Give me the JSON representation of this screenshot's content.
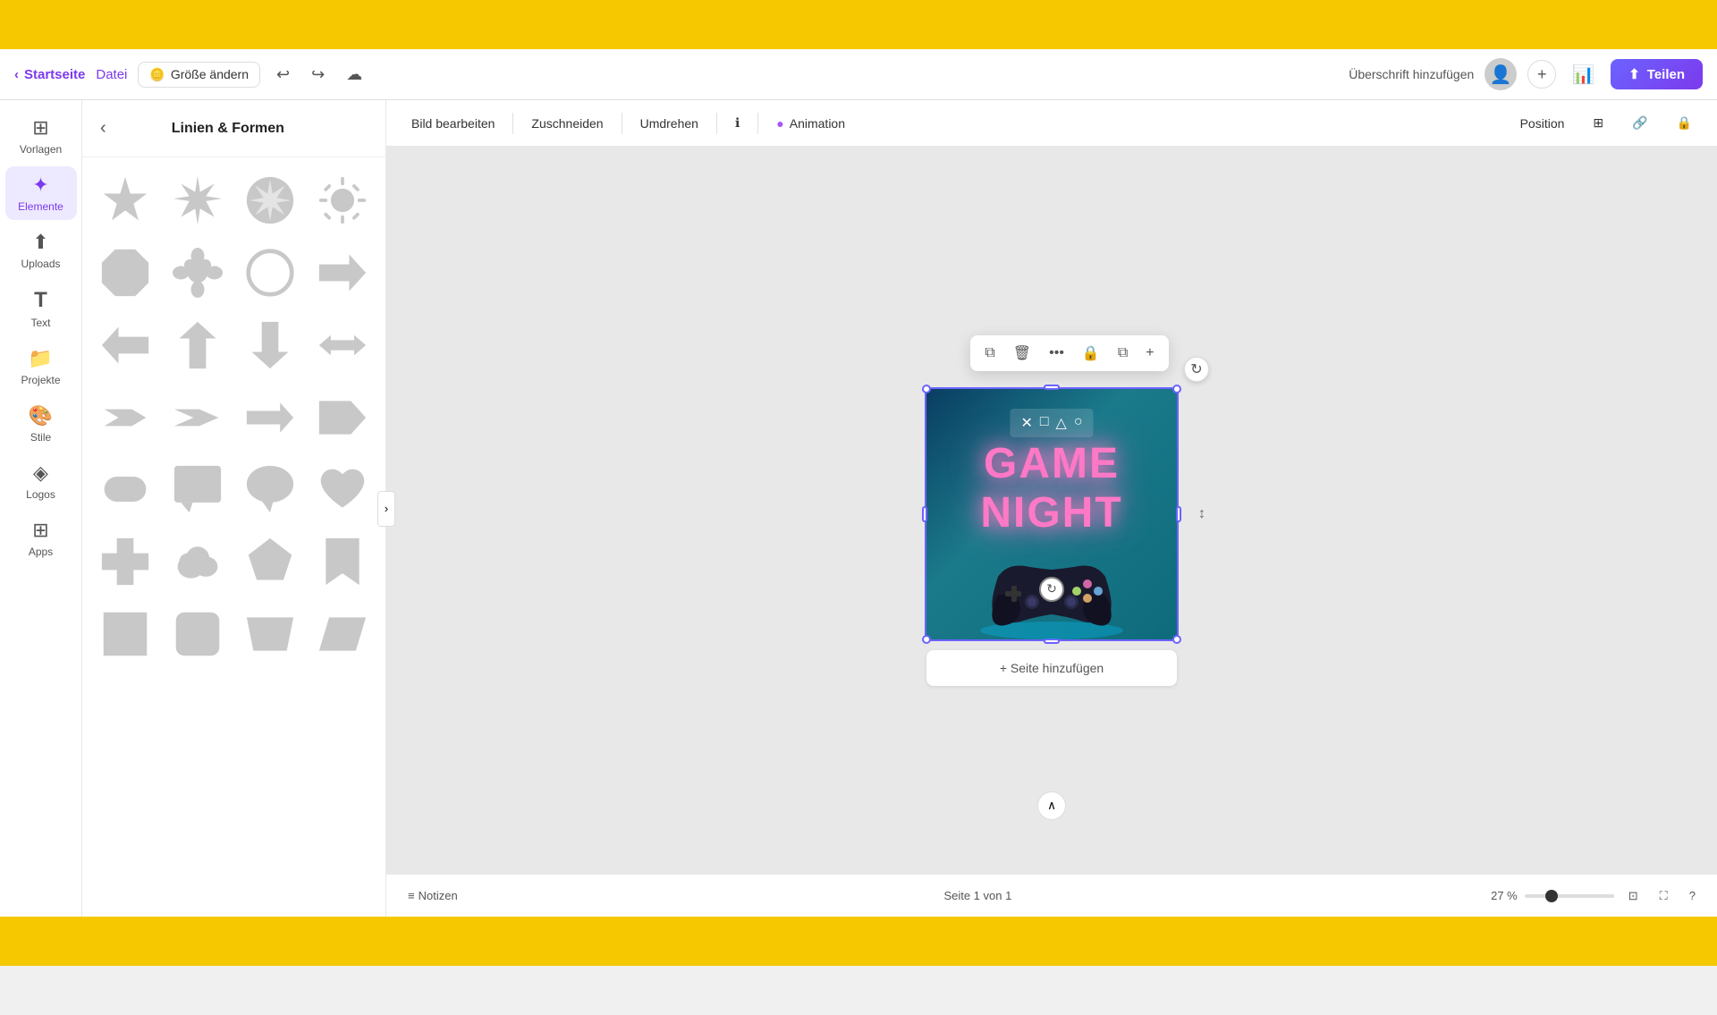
{
  "topBar": {
    "bg": "#f5c800"
  },
  "navbar": {
    "home_label": "Startseite",
    "datei_label": "Datei",
    "groesse_label": "Größe ändern",
    "coin_icon": "🪙",
    "undo_icon": "↩",
    "redo_icon": "↪",
    "cloud_icon": "☁",
    "add_title": "Überschrift hinzufügen",
    "share_label": "Teilen",
    "share_icon": "⬆"
  },
  "toolbar": {
    "bild_bearbeiten": "Bild bearbeiten",
    "zuschneiden": "Zuschneiden",
    "umdrehen": "Umdrehen",
    "info_icon": "ℹ",
    "animation_icon": "●",
    "animation": "Animation",
    "position": "Position",
    "link_icon": "🔗",
    "lock_icon": "🔒"
  },
  "sidebar": {
    "items": [
      {
        "id": "vorlagen",
        "label": "Vorlagen",
        "icon": "⊞"
      },
      {
        "id": "elemente",
        "label": "Elemente",
        "icon": "✦",
        "active": true
      },
      {
        "id": "uploads",
        "label": "Uploads",
        "icon": "⬆"
      },
      {
        "id": "text",
        "label": "Text",
        "icon": "T"
      },
      {
        "id": "projekte",
        "label": "Projekte",
        "icon": "📁"
      },
      {
        "id": "stile",
        "label": "Stile",
        "icon": "🎨"
      },
      {
        "id": "logos",
        "label": "Logos",
        "icon": "◈"
      },
      {
        "id": "apps",
        "label": "Apps",
        "icon": "⊞"
      }
    ]
  },
  "panel": {
    "title": "Linien & Formen",
    "back_icon": "‹"
  },
  "canvas": {
    "design_title_line1": "GAME",
    "design_title_line2": "NIGHT",
    "add_page_label": "+ Seite hinzufügen"
  },
  "contextToolbar": {
    "copy_icon": "⧉",
    "delete_icon": "🗑",
    "more_icon": "•••",
    "lock_icon": "🔒",
    "duplicate_icon": "⧉",
    "expand_icon": "+"
  },
  "bottomBar": {
    "notes_icon": "≡",
    "notes_label": "Notizen",
    "page_info": "Seite 1 von 1",
    "zoom_level": "27 %",
    "collapse_icon": "∧",
    "page_icon": "⊡",
    "fullscreen_icon": "⛶",
    "help_icon": "?"
  }
}
